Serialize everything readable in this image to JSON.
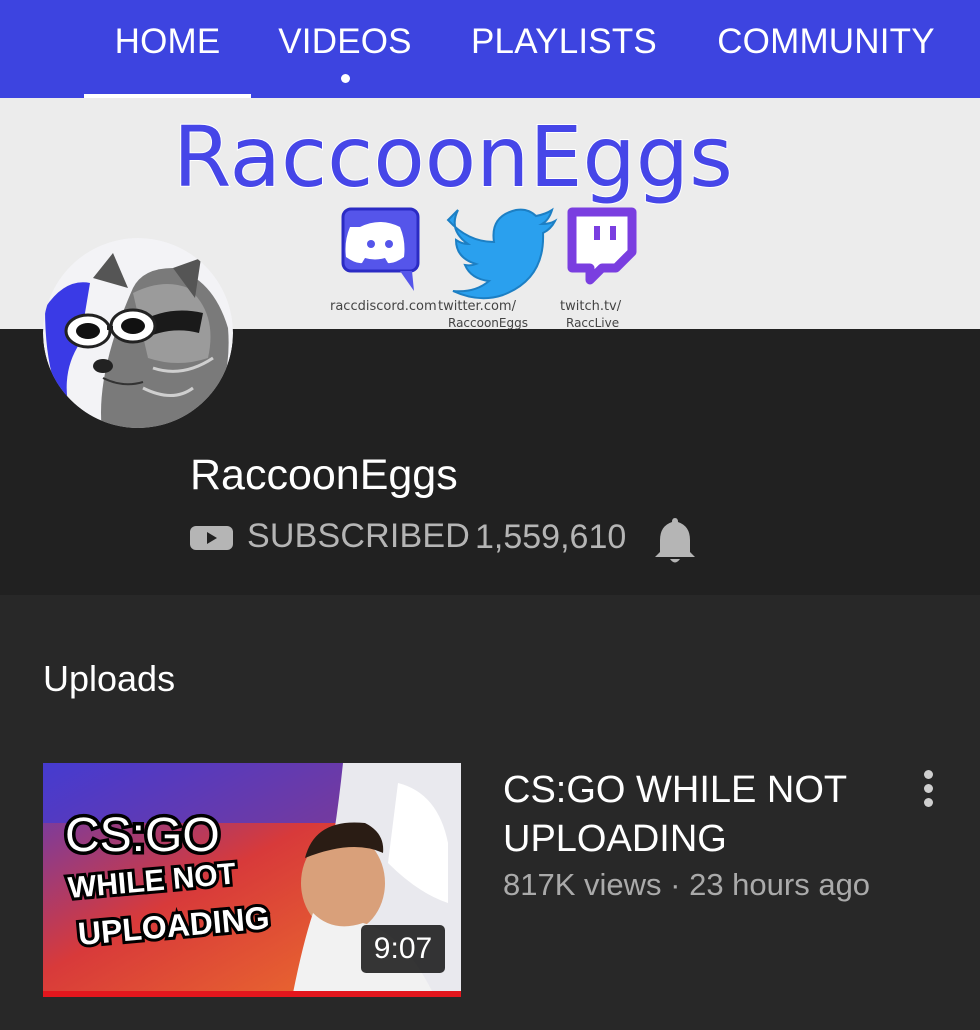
{
  "tabs": [
    {
      "label": "HOME",
      "active": true
    },
    {
      "label": "VIDEOS",
      "active": false
    },
    {
      "label": "PLAYLISTS",
      "active": false
    },
    {
      "label": "COMMUNITY",
      "active": false
    }
  ],
  "banner": {
    "title": "RaccoonEggs",
    "links": [
      {
        "icon": "discord-icon",
        "line1": "raccdiscord.com",
        "line2": ""
      },
      {
        "icon": "twitter-icon",
        "line1": "twitter.com/",
        "line2": "RaccoonEggs"
      },
      {
        "icon": "twitch-icon",
        "line1": "twitch.tv/",
        "line2": "RaccLive"
      }
    ]
  },
  "channel": {
    "name": "RaccoonEggs",
    "subscribed_label": "SUBSCRIBED",
    "subscriber_count": "1,559,610"
  },
  "uploads": {
    "title": "Uploads",
    "videos": [
      {
        "title": "CS:GO WHILE NOT UPLOADING",
        "meta": "817K views · 23 hours ago",
        "duration": "9:07",
        "thumbnail_text": [
          "CS:GO",
          "WHILE NOT",
          "UPLOADING"
        ],
        "watched_fraction": 1.0
      }
    ]
  },
  "colors": {
    "tab_bar": "#3d44e0",
    "header_bg": "#212121",
    "page_bg": "#282828",
    "progress_red": "#e3161d",
    "banner_ink": "#3e3ee6"
  }
}
